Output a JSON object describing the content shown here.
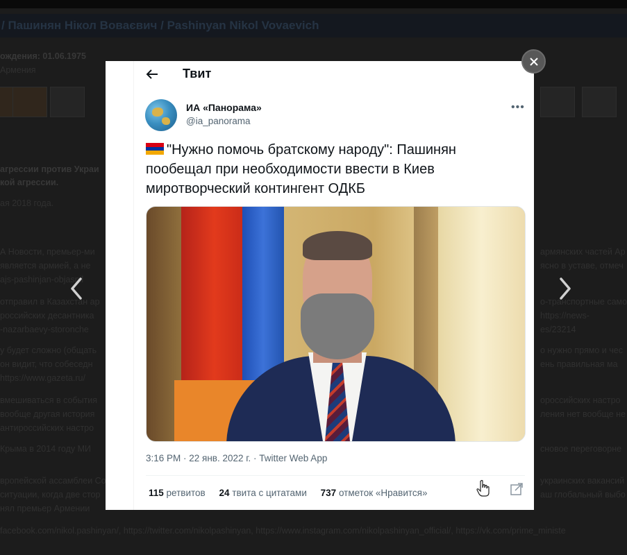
{
  "background_page": {
    "title": "/ Пашинян Нікол Вовaєвич / Pashinyan Nikol Vovaevich",
    "lines": [
      "ождения: 01.06.1975",
      "Армения",
      "агрессии против Украи",
      "кой агрессии.",
      "ая 2018 года.",
      "А Новости, премьер-ми",
      "является армией, а не",
      "ajs-pashinjan-objasnil",
      "отправил в Казахстан ар",
      "российских десантника",
      "-nazarbaevy-storonche",
      "у будет сложно (общать",
      "он видит, что собеседн",
      "https://www.gazeta.ru/",
      "вмешиваться в события",
      "вообще другая история",
      "антироссийских настро",
      "Крыма в 2014 году МИ",
      "вропейской ассамблеи Сове",
      "ситуации, когда две стор",
      "нял премьер Армении",
      "facebook.com/nikol.pashinyan/, https://twitter.com/nikolpashinyan, https://www.instagram.com/nikolpashinyan_official/, https://vk.com/prime_ministe"
    ],
    "right_lines": [
      "армянских частей Ар",
      "ясно в уставе, отмеч",
      "о-транспортные самол",
      "https://news-",
      "es/23214",
      "о нужно прямо и чес",
      "ень правильная ма",
      "ороссийских настро",
      "ления нет вообще не",
      "сновое переговорне",
      "украинских вакансий",
      "аш глобальный выбо"
    ]
  },
  "modal": {
    "close_icon": "close-icon",
    "nav_prev_icon": "chevron-left-icon",
    "nav_next_icon": "chevron-right-icon"
  },
  "tweet": {
    "header_title": "Твит",
    "author_name": "ИА «Панорама»",
    "author_handle": "@ia_panorama",
    "more_label": "•••",
    "text": "\"Нужно помочь братскому народу\": Пашинян пообещал при необходимости ввести в Киев миротворческий контингент ОДКБ",
    "flag_colors": [
      "#d90012",
      "#0033a0",
      "#f2a800"
    ],
    "meta": "3:16 PM · 22 янв. 2022 г. · Twitter Web App",
    "stats": [
      {
        "num": "115",
        "label": "ретвитов"
      },
      {
        "num": "24",
        "label": "твита с цитатами"
      },
      {
        "num": "737",
        "label": "отметок «Нравится»"
      }
    ]
  },
  "colors": {
    "text_primary": "#0f1419",
    "text_secondary": "#536471",
    "overlay": "#2b2b2b"
  }
}
